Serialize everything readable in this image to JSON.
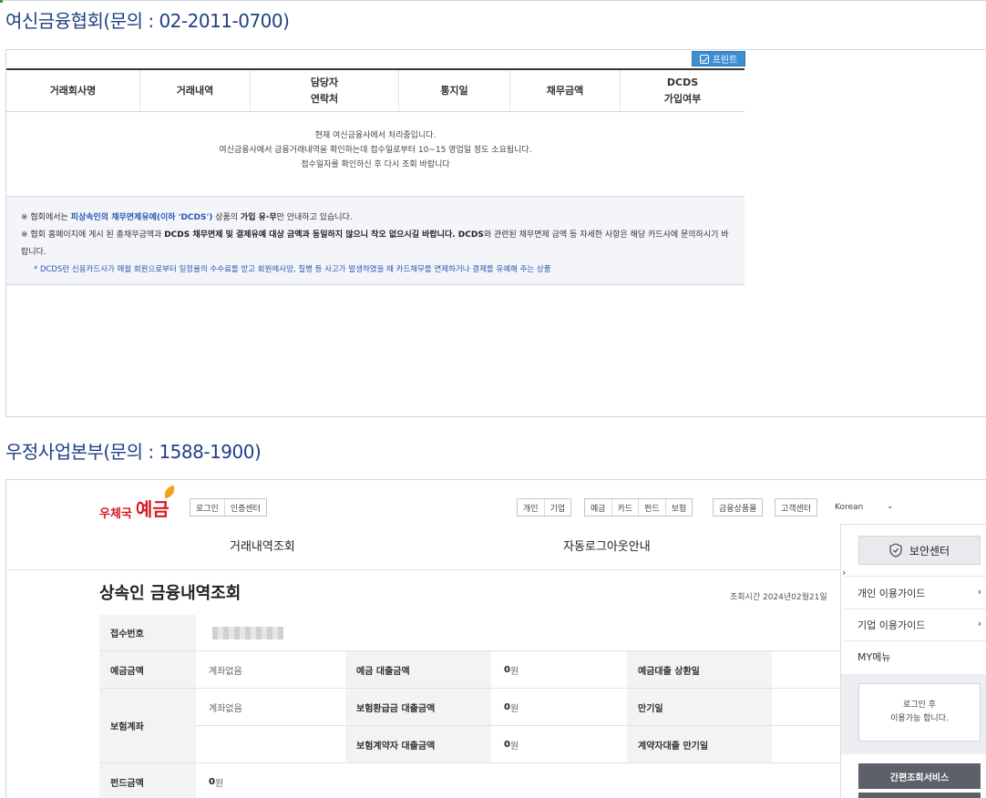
{
  "section1": {
    "title": "여신금융협회(문의 : 02-2011-0700)",
    "print_label": "프린트",
    "columns": [
      "거래회사명",
      "거래내역",
      "담당자\n연락처",
      "통지일",
      "채무금액",
      "DCDS\n가입여부"
    ],
    "message_lines": [
      "현재 여신금융사에서 처리중입니다.",
      "여신금융사에서 금융거래내역을 확인하는데 접수일로부터 10~15 영업일 정도 소요됩니다.",
      "접수일자를 확인하신 후 다시 조회 바랍니다"
    ],
    "notice": {
      "line1_prefix": "※ 협회에서는 ",
      "line1_highlight": "피상속인의 채무면제유예(이하 'DCDS')",
      "line1_mid": " 상품의 ",
      "line1_bold": "가입 유·무",
      "line1_suffix": "만 안내하고 있습니다.",
      "line2_prefix": "※ 협회 홈페이지에 게시 된 총채무금액과 ",
      "line2_bold": "DCDS 채무면제 및 결제유예 대상 금액과 동일하지 않으니 착오 없으시길    바랍니다. DCDS",
      "line2_suffix": "와 관련된 채무면제 금액 등 자세한 사항은 해당 카드사에 문의하시기 바랍니다.",
      "line3": "* DCDS란 신용카드사가 매월 회원으로부터 일정율의 수수료를 받고 회원에사망, 질병 등 사고가 발생하였을 때 카드채무를   면제하거나 결제를 유예해 주는 상품"
    }
  },
  "section2": {
    "title": "우정사업본부(문의 : 1588-1900)",
    "logo_text1": "우체국",
    "logo_text2": "예금",
    "auth_buttons": [
      "로그인",
      "인증센터"
    ],
    "type_buttons": [
      "개인",
      "기업"
    ],
    "product_buttons": [
      "예금",
      "카드",
      "펀드",
      "보험"
    ],
    "mall_button": "금융상품몰",
    "cs_button": "고객센터",
    "language": "Korean",
    "menu": [
      "거래내역조회",
      "자동로그아웃안내"
    ],
    "page_title": "상속인 금융내역조회",
    "query_time": "조회시간 2024년02월21일",
    "rows": {
      "receipt_label": "접수번호",
      "deposit_label": "예금금액",
      "deposit_value": "계좌없음",
      "deposit_loan_label": "예금 대출금액",
      "deposit_loan_value": "0",
      "deposit_repay_label": "예금대출 상환일",
      "insurance_label": "보험계좌",
      "insurance_value": "계좌없음",
      "ins_refund_loan_label": "보험환급금 대출금액",
      "ins_refund_loan_value": "0",
      "maturity_label": "만기일",
      "ins_contract_loan_label": "보험계약자 대출금액",
      "ins_contract_loan_value": "0",
      "contract_loan_maturity_label": "계약자대출 만기일",
      "fund_label": "펀드금액",
      "fund_value": "0",
      "currency_unit": "원"
    },
    "sidebar": {
      "security_center": "보안센터",
      "personal_guide": "개인 이용가이드",
      "business_guide": "기업 이용가이드",
      "my_menu": "MY메뉴",
      "login_notice": "로그인 후\n이용가능 합니다.",
      "quick_service": "간편조회서비스"
    }
  }
}
